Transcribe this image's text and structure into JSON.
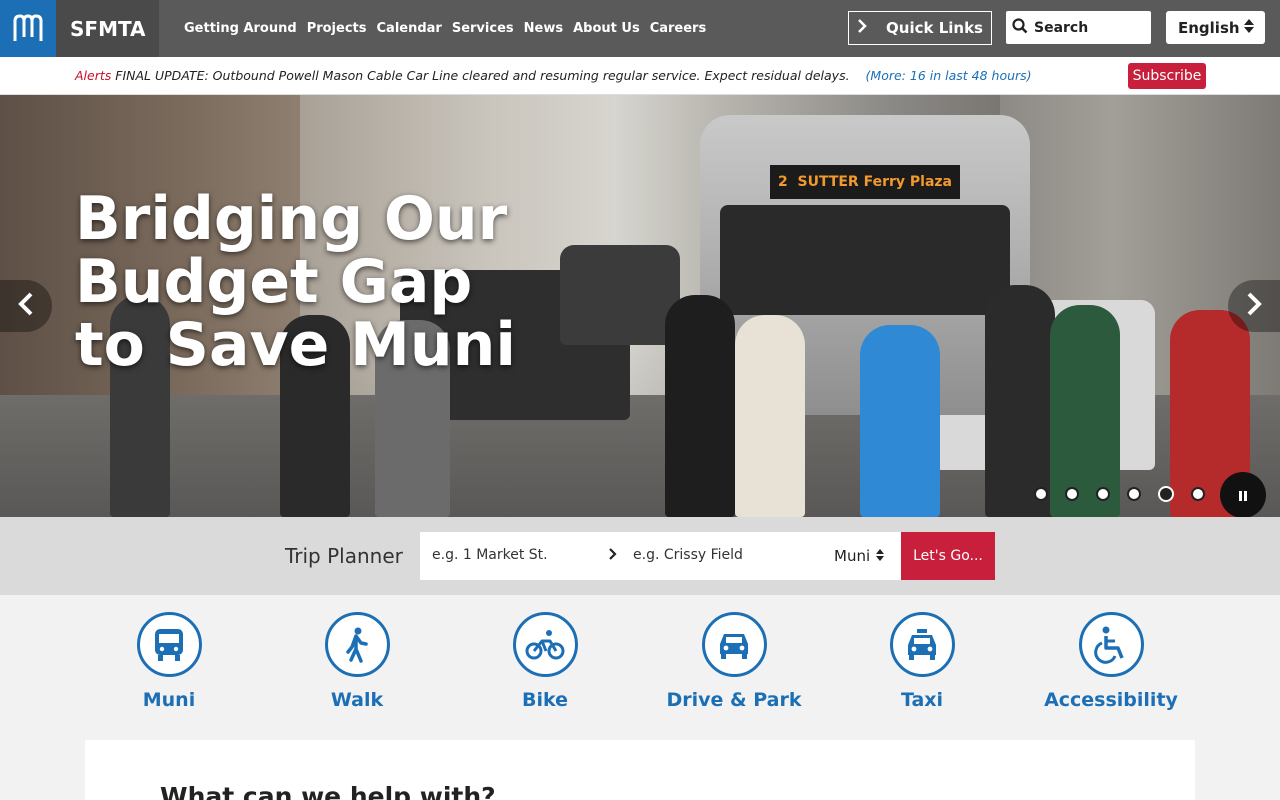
{
  "header": {
    "brand": "SFMTA",
    "nav": [
      "Getting Around",
      "Projects",
      "Calendar",
      "Services",
      "News",
      "About Us",
      "Careers"
    ],
    "quick_links": "Quick Links",
    "search_placeholder": "Search",
    "language": "English"
  },
  "alert": {
    "label": "Alerts",
    "message": "FINAL UPDATE: Outbound Powell Mason Cable Car Line cleared and resuming regular service. Expect residual delays.",
    "more": "(More: 16 in last 48 hours)",
    "subscribe": "Subscribe"
  },
  "hero": {
    "title_lines": [
      "Bridging Our",
      "Budget Gap",
      "to Save Muni"
    ],
    "bus_sign_route": "2",
    "bus_sign_line1": "SUTTER",
    "bus_sign_line2": "Ferry Plaza",
    "slide_count": 6,
    "active_slide": 5
  },
  "trip_planner": {
    "label": "Trip Planner",
    "from_placeholder": "e.g. 1 Market St.",
    "to_placeholder": "e.g. Crissy Field",
    "mode": "Muni",
    "submit": "Let's Go..."
  },
  "modes": [
    {
      "label": "Muni",
      "icon": "bus-icon"
    },
    {
      "label": "Walk",
      "icon": "walk-icon"
    },
    {
      "label": "Bike",
      "icon": "bike-icon"
    },
    {
      "label": "Drive & Park",
      "icon": "car-icon"
    },
    {
      "label": "Taxi",
      "icon": "taxi-icon"
    },
    {
      "label": "Accessibility",
      "icon": "wheelchair-icon"
    }
  ],
  "help": {
    "title": "What can we help with?"
  },
  "colors": {
    "brand_blue": "#1c6fb5",
    "accent_red": "#c8203c",
    "header_gray": "#5a5a5a"
  }
}
